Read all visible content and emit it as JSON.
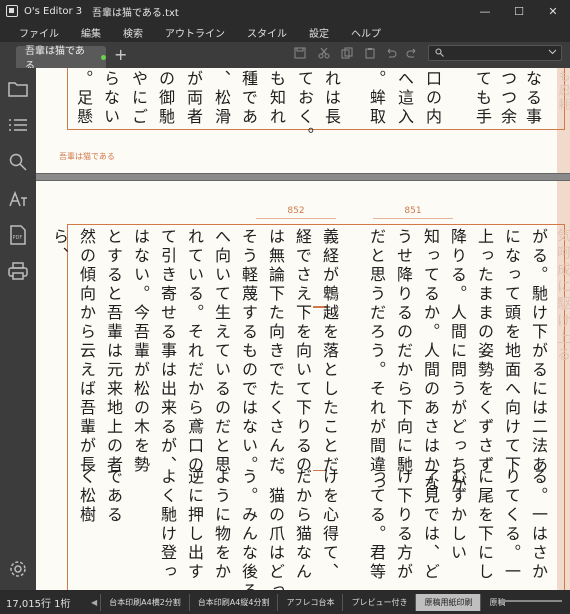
{
  "window": {
    "app_title": "O's Editor 3",
    "doc_title": "吾輩は猫である.txt",
    "controls": [
      "—",
      "☐",
      "✕"
    ]
  },
  "menu": [
    "ファイル",
    "編集",
    "検索",
    "アウトライン",
    "スタイル",
    "設定",
    "ヘルプ"
  ],
  "tab": {
    "label": "吾輩は猫である",
    "add": "+"
  },
  "search": {
    "placeholder": "",
    "value": ""
  },
  "document": {
    "caption": "吾輩は猫である",
    "page_numbers": [
      "852",
      "851"
    ],
    "top_columns": [
      "なる事",
      "つつ余",
      "ても手",
      "口の内",
      "へ這入",
      "。蛑取",
      "れは長",
      "ておく。",
      "も知れ",
      "種であ",
      "、松滑",
      "が両者",
      "の御馳",
      "やにご",
      "らない",
      "。足懸"
    ],
    "top_faded": "も忍耗",
    "main_columns": [
      "がる。馳け下がるには二法あ",
      "になって頭を地面へ向けて下",
      "上ったままの姿勢をくずさず",
      "降りる。人間に問うがどっちが",
      "知ってるか。人間のあさはかな",
      "うせ降りるのだから下向に馳",
      "だと思うだろう。それが間違っ",
      "義経が鵯越を落としたことだ",
      "経でさえ下を向いて下りるの",
      "は無論下た向きでたくさんだ",
      "そう軽蔑するものではない。",
      "へ向いて生えているのだと思",
      "れている。それだから鳶口の",
      "て引き寄せる事は出来るが、",
      "はない。今吾輩が松の木を勢",
      "とすると吾輩は元来地上の者",
      "然の傾向から云えば吾輩が長",
      "ら、"
    ],
    "main_columns_cont": [
      "る。一はさか",
      "りてくる。一",
      "に尾を下にし",
      "むずかしい",
      "了見では、ど",
      "け下りる方が",
      "ってる。君等",
      "けを心得て、",
      "だから猫なん",
      "。猫の爪はどっ",
      "う。みんな後ろへ",
      "ように物をか",
      "逆に押し出す",
      "よく馳け登っ",
      "である",
      "く松樹"
    ],
    "right_faded": "気呵成に駆け上る"
  },
  "status": {
    "position": "17,015行  1桁",
    "tabs": [
      "台本印刷A4横2分割",
      "台本印刷A4縦4分割",
      "アフレコ台本",
      "プレビュー付き",
      "原稿用紙印刷",
      "原稿"
    ],
    "active_tab": "原稿用紙印刷",
    "zoom_fraction": 0.3
  },
  "icons": {
    "toolbar": [
      "save-icon",
      "cut-icon",
      "copy-icon",
      "paste-icon",
      "undo-icon",
      "redo-icon"
    ],
    "sidebar": [
      "folder-icon",
      "list-icon",
      "search-icon",
      "font-size-icon",
      "pdf-icon",
      "print-icon",
      "gear-icon"
    ]
  }
}
